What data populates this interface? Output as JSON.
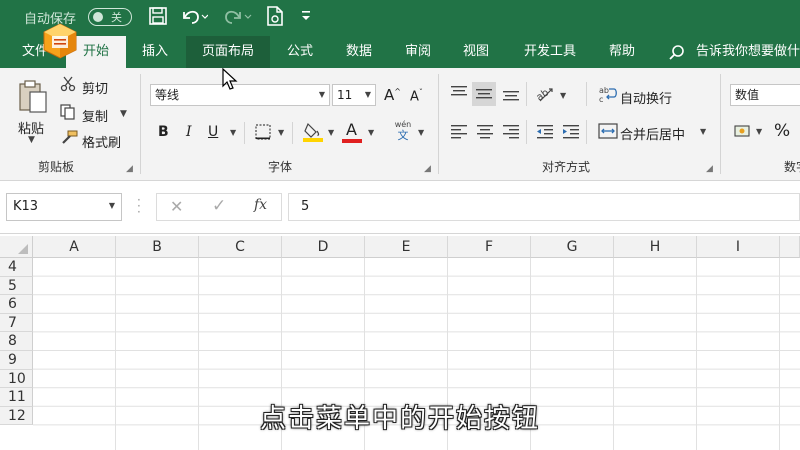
{
  "titlebar": {
    "autosave_label": "自动保存",
    "autosave_state": "关",
    "save_icon": "save-icon",
    "undo_icon": "undo-icon",
    "redo_icon": "redo-icon",
    "quickaccess_icon": "document-icon",
    "customize_icon": "chevron-down-icon"
  },
  "tabs": [
    {
      "label": "文件"
    },
    {
      "label": "开始"
    },
    {
      "label": "插入"
    },
    {
      "label": "页面布局"
    },
    {
      "label": "公式"
    },
    {
      "label": "数据"
    },
    {
      "label": "审阅"
    },
    {
      "label": "视图"
    },
    {
      "label": "开发工具"
    },
    {
      "label": "帮助"
    },
    {
      "label": "告诉我你想要做什"
    }
  ],
  "ribbon": {
    "clipboard": {
      "paste": "粘贴",
      "cut": "剪切",
      "copy": "复制",
      "format_painter": "格式刷",
      "group_label": "剪贴板"
    },
    "font": {
      "font_name": "等线",
      "font_size": "11",
      "increase": "A",
      "decrease": "A",
      "bold": "B",
      "italic": "I",
      "underline": "U",
      "font_color_glyph": "A",
      "phonetic_top": "wén",
      "phonetic_bottom": "文",
      "group_label": "字体"
    },
    "alignment": {
      "wrap_text": "自动换行",
      "merge_center": "合并后居中",
      "group_label": "对齐方式"
    },
    "number": {
      "format": "数值",
      "percent": "%",
      "group_label": "数字"
    }
  },
  "formula_bar": {
    "name_box": "K13",
    "cancel": "✕",
    "enter": "✓",
    "fx": "fx",
    "value": "5"
  },
  "grid": {
    "columns": [
      "A",
      "B",
      "C",
      "D",
      "E",
      "F",
      "G",
      "H",
      "I"
    ],
    "rows": [
      "4",
      "5",
      "6",
      "7",
      "8",
      "9",
      "10",
      "11",
      "12"
    ]
  },
  "caption": "点击菜单中的开始按钮",
  "colors": {
    "brand": "#217346",
    "ribbon_bg": "#f3f3f3",
    "font_color_bar": "#e02020",
    "highlight_bar": "#ffd400"
  }
}
